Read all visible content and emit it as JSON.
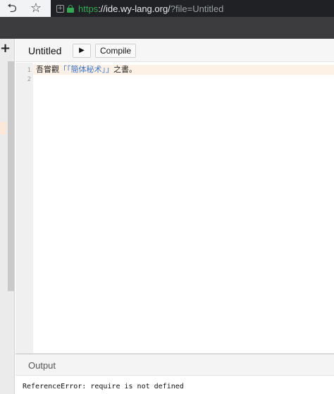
{
  "browser": {
    "url_scheme": "https",
    "url_host": "://ide.wy-lang.org/",
    "url_path": "?file=Untitled",
    "icons": {
      "reload": "reload-icon",
      "bookmark": "star-icon",
      "secure": "lock-icon"
    }
  },
  "sidebar": {
    "add_label": "+"
  },
  "toolbar": {
    "title": "Untitled",
    "run_label": "▶",
    "compile_label": "Compile"
  },
  "editor": {
    "line_numbers": [
      "1",
      "2"
    ],
    "line1": {
      "kw1": "吾嘗觀",
      "open_outer": "「",
      "open_inner": "「",
      "module": "簡体秘术",
      "close_inner": "」",
      "close_outer": "」",
      "kw2": "之書。"
    }
  },
  "output": {
    "title": "Output",
    "text": "ReferenceError: require is not defined"
  },
  "colors": {
    "header_bg": "#3c3c3f",
    "url_bar_bg": "#202124",
    "secure_green": "#34a853",
    "active_line": "#fdf1e6",
    "string_blue": "#3b74c4"
  }
}
